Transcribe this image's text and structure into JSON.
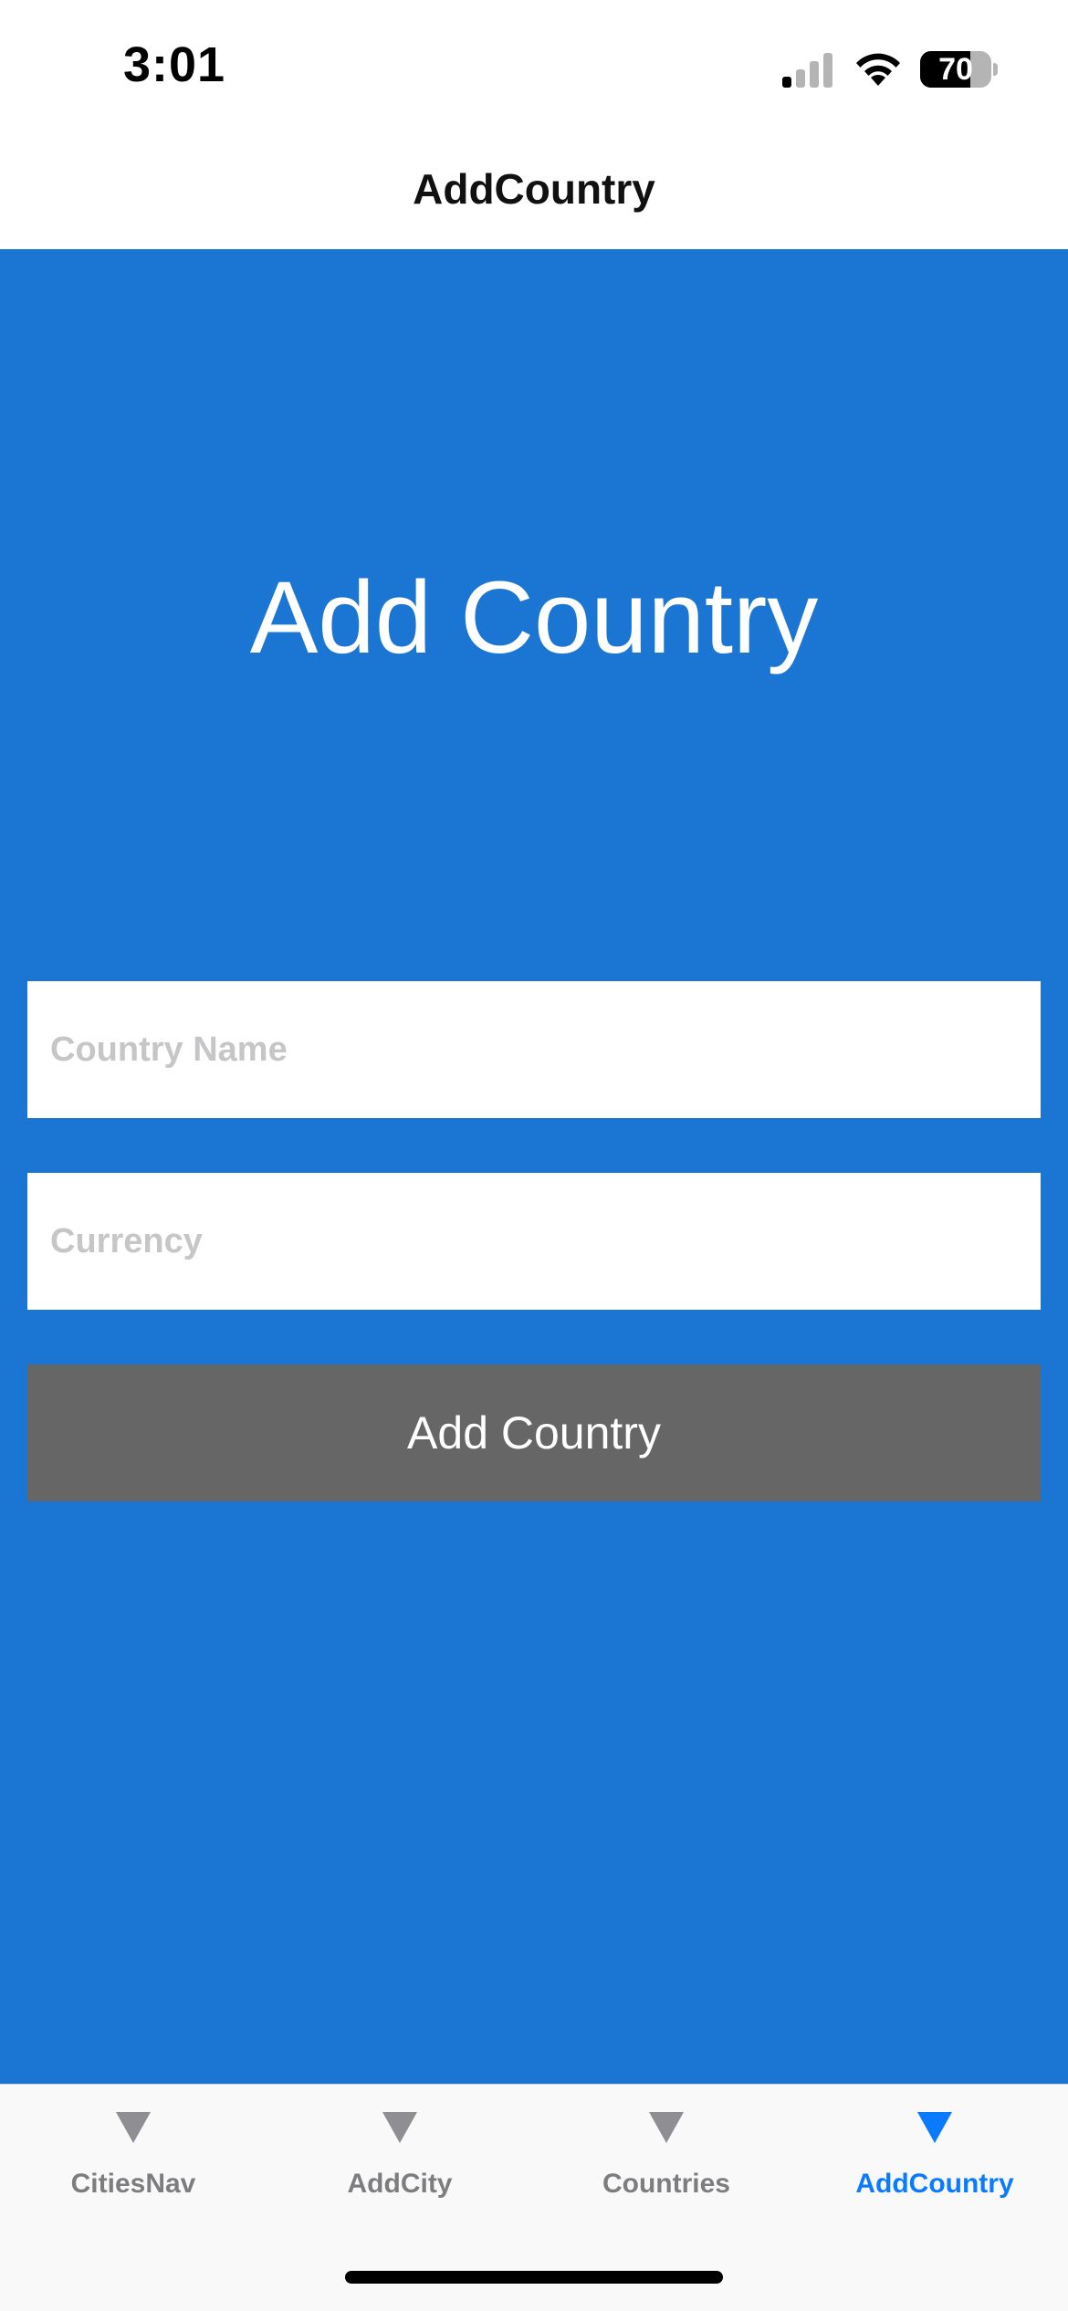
{
  "status_bar": {
    "time": "3:01",
    "battery_level": "70",
    "battery_fraction": 0.7
  },
  "nav_bar": {
    "title": "AddCountry"
  },
  "form": {
    "heading": "Add Country",
    "country_name_placeholder": "Country Name",
    "currency_placeholder": "Currency",
    "submit_label": "Add Country",
    "background_color": "#1b76d3",
    "button_color": "#666666"
  },
  "tab_bar": {
    "active_color": "#0a7aff",
    "inactive_color": "#8e8e93",
    "tabs": [
      {
        "label": "CitiesNav",
        "icon": "triangle-down-icon",
        "active": false
      },
      {
        "label": "AddCity",
        "icon": "triangle-down-icon",
        "active": false
      },
      {
        "label": "Countries",
        "icon": "triangle-down-icon",
        "active": false
      },
      {
        "label": "AddCountry",
        "icon": "triangle-down-icon",
        "active": true
      }
    ]
  }
}
